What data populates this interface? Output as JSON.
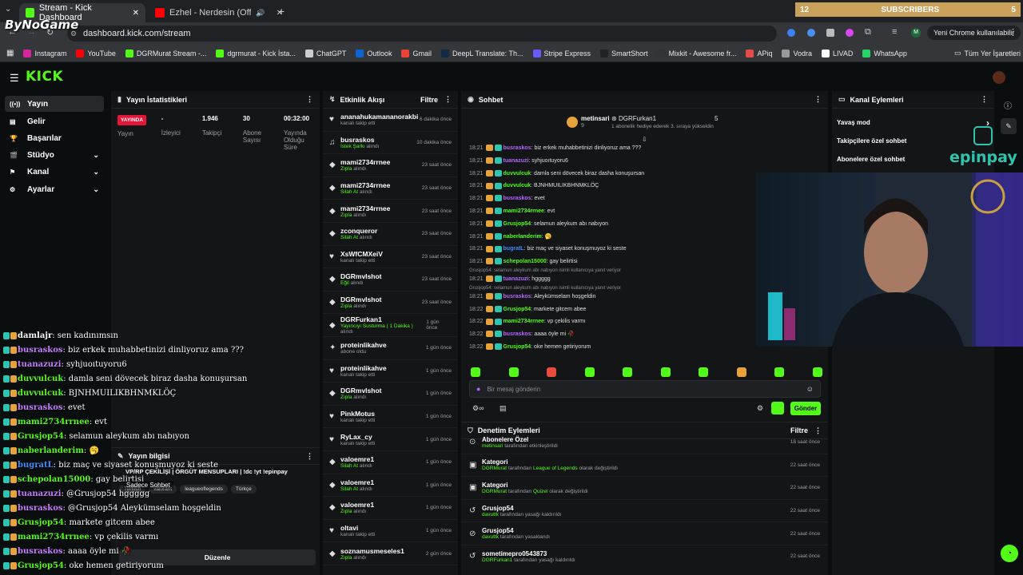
{
  "browser": {
    "tabs": [
      {
        "title": "Stream - Kick Dashboard"
      },
      {
        "title": "Ezhel - Nerdesin (Official Au"
      }
    ],
    "url": "dashboard.kick.com/stream",
    "profile_button": "Yeni Chrome kullanılabilir",
    "bookmarks": [
      {
        "label": "Instagram",
        "color": "#d6249f"
      },
      {
        "label": "YouTube",
        "color": "#ff0000"
      },
      {
        "label": "DGRMurat Stream -...",
        "color": "#53fc18"
      },
      {
        "label": "dgrmurat - Kick İsta...",
        "color": "#53fc18"
      },
      {
        "label": "ChatGPT",
        "color": "#cccccc"
      },
      {
        "label": "Outlook",
        "color": "#0a64d6"
      },
      {
        "label": "Gmail",
        "color": "#ea4335"
      },
      {
        "label": "DeepL Translate: Th...",
        "color": "#0f2b46"
      },
      {
        "label": "Stripe Express",
        "color": "#635bff"
      },
      {
        "label": "SmartShort",
        "color": "#222222"
      },
      {
        "label": "Mixkit - Awesome fr...",
        "color": "#333333"
      },
      {
        "label": "APiq",
        "color": "#e64a4a"
      },
      {
        "label": "Vodra",
        "color": "#999999"
      },
      {
        "label": "LIVAD",
        "color": "#ffffff"
      },
      {
        "label": "WhatsApp",
        "color": "#25d366"
      }
    ],
    "all_bookmarks": "Tüm Yer İşaretleri"
  },
  "overlay": {
    "logo": "ByNoGame",
    "subscribers_count_left": "12",
    "subscribers_label": "SUBSCRIBERS",
    "subscribers_count_right": "5",
    "sponsor": "epinpay"
  },
  "sidebar": {
    "items": [
      {
        "label": "Yayın",
        "icon": "broadcast-icon",
        "glyph": "((•))"
      },
      {
        "label": "Gelir",
        "icon": "wallet-icon",
        "glyph": "▤"
      },
      {
        "label": "Başarılar",
        "icon": "trophy-icon",
        "glyph": "🏆"
      },
      {
        "label": "Stüdyo",
        "icon": "studio-icon",
        "glyph": "🎬"
      },
      {
        "label": "Kanal",
        "icon": "channel-icon",
        "glyph": "⚑"
      },
      {
        "label": "Ayarlar",
        "icon": "settings-icon",
        "glyph": "⚙"
      }
    ]
  },
  "stats": {
    "title": "Yayın İstatistikleri",
    "live_badge": "YAYINDA",
    "live_label": "Yayın",
    "viewers_value": "-",
    "viewers_label": "İzleyici",
    "followers_value": "1.946",
    "followers_label": "Takipçi",
    "subs_value": "30",
    "subs_label": "Abone Sayısı",
    "uptime_value": "00:32:00",
    "uptime_label": "Yayında Olduğu Süre"
  },
  "stream_info": {
    "title": "Yayın bilgisi",
    "stream_title": "VP/RP ÇEKİLİŞİ | ÖRGÜT MENSUPLARI | !dc !yt !epinpay",
    "tags": [
      "Turkish",
      "valorant",
      "leagueoflegends",
      "Türkçe"
    ],
    "edit_button": "Düzenle"
  },
  "activity": {
    "title": "Etkinlik Akışı",
    "filter": "Filtre",
    "items": [
      {
        "icon": "♥",
        "user": "ananahukamananorakbi",
        "action": "kanalı takip etti",
        "highlight": "",
        "time": "6 dakika önce"
      },
      {
        "icon": "♫",
        "user": "busraskos",
        "action": "alındı",
        "highlight": "İstek Şarkı",
        "time": "10 dakika önce"
      },
      {
        "icon": "◆",
        "user": "mami2734rrnee",
        "action": "alındı",
        "highlight": "Zıpla",
        "time": "23 saat önce"
      },
      {
        "icon": "◆",
        "user": "mami2734rrnee",
        "action": "alındı",
        "highlight": "Silah At",
        "time": "23 saat önce"
      },
      {
        "icon": "◆",
        "user": "mami2734rrnee",
        "action": "alındı",
        "highlight": "Zıpla",
        "time": "23 saat önce"
      },
      {
        "icon": "◆",
        "user": "zconqueror",
        "action": "alındı",
        "highlight": "Silah At",
        "time": "23 saat önce"
      },
      {
        "icon": "♥",
        "user": "XsWfCMXeiV",
        "action": "kanalı takip etti",
        "highlight": "",
        "time": "23 saat önce"
      },
      {
        "icon": "◆",
        "user": "DGRmvlshot",
        "action": "alındı",
        "highlight": "Eğil",
        "time": "23 saat önce"
      },
      {
        "icon": "◆",
        "user": "DGRmvlshot",
        "action": "alındı",
        "highlight": "Zıpla",
        "time": "23 saat önce"
      },
      {
        "icon": "◆",
        "user": "DGRFurkan1",
        "action": "alındı",
        "highlight": "Yayıncıyı Susturma ( 1 Dakika )",
        "time": "1 gün önce"
      },
      {
        "icon": "✦",
        "user": "proteinlikahve",
        "action": "abone oldu",
        "highlight": "",
        "time": "1 gün önce"
      },
      {
        "icon": "♥",
        "user": "proteinlikahve",
        "action": "kanalı takip etti",
        "highlight": "",
        "time": "1 gün önce"
      },
      {
        "icon": "◆",
        "user": "DGRmvlshot",
        "action": "alındı",
        "highlight": "Zıpla",
        "time": "1 gün önce"
      },
      {
        "icon": "♥",
        "user": "PinkMotus",
        "action": "kanalı takip etti",
        "highlight": "",
        "time": "1 gün önce"
      },
      {
        "icon": "♥",
        "user": "RyLax_cy",
        "action": "kanalı takip etti",
        "highlight": "",
        "time": "1 gün önce"
      },
      {
        "icon": "◆",
        "user": "valoemre1",
        "action": "alındı",
        "highlight": "Silah At",
        "time": "1 gün önce"
      },
      {
        "icon": "◆",
        "user": "valoemre1",
        "action": "alındı",
        "highlight": "Silah At",
        "time": "1 gün önce"
      },
      {
        "icon": "◆",
        "user": "valoemre1",
        "action": "alındı",
        "highlight": "Zıpla",
        "time": "1 gün önce"
      },
      {
        "icon": "♥",
        "user": "oltavi",
        "action": "kanalı takip etti",
        "highlight": "",
        "time": "1 gün önce"
      },
      {
        "icon": "◆",
        "user": "soznamusmeseles1",
        "action": "alındı",
        "highlight": "Zıpla",
        "time": "2 gün önce"
      }
    ]
  },
  "chat": {
    "title": "Sohbet",
    "pinned_user": "metinsari",
    "pinned_level": "9",
    "gifter": "DGRFurkan1",
    "gift_count": "5",
    "gift_text": "1 abonelik hediye ederek 3. sıraya yükseldin",
    "messages": [
      {
        "time": "18:21",
        "user": "busraskos",
        "color": "#b765ff",
        "text": ": biz erkek muhabbetinizi dinliyoruz ama ???"
      },
      {
        "time": "18:21",
        "user": "tuanazuzi",
        "color": "#b765ff",
        "text": ": syhjuoıtuyoru6"
      },
      {
        "time": "18:21",
        "user": "duvvulcuk",
        "color": "#53fc18",
        "text": ": damla seni dövecek biraz dasha konuşursan"
      },
      {
        "time": "18:21",
        "user": "duvvulcuk",
        "color": "#53fc18",
        "text": ": BJNHMUILIKBHNMKLÖÇ"
      },
      {
        "time": "18:21",
        "user": "busraskos",
        "color": "#b765ff",
        "text": ": evet"
      },
      {
        "time": "18:21",
        "user": "mami2734rrnee",
        "color": "#53fc18",
        "text": ": evt"
      },
      {
        "time": "18:21",
        "user": "Grusjop54",
        "color": "#53fc18",
        "text": ": selamun aleykum abı nabıyon"
      },
      {
        "time": "18:21",
        "user": "naberlanderim",
        "color": "#53fc18",
        "text": ": 🥱"
      },
      {
        "time": "18:21",
        "user": "bugratL",
        "color": "#3f8cff",
        "text": ": biz maç ve siyaset konuşmuyoz ki seste"
      },
      {
        "time": "18:21",
        "user": "schepolan15000",
        "color": "#53fc18",
        "text": ": gay belirtisi"
      },
      {
        "time": "18:21",
        "user": "tuanazuzi",
        "color": "#b765ff",
        "text": ": hggggg",
        "note": "Grusjop54: selamun aleykum abı nabıyon isimli kullanıcıya yanıt veriyor"
      },
      {
        "time": "18:21",
        "user": "busraskos",
        "color": "#b765ff",
        "text": ": Aleykümselam hoşgeldin",
        "note": "Grusjop54: selamun aleykum abı nabıyon isimli kullanıcıya yanıt veriyor"
      },
      {
        "time": "18:22",
        "user": "Grusjop54",
        "color": "#53fc18",
        "text": ": markete gitcem abee"
      },
      {
        "time": "18:22",
        "user": "mami2734rrnee",
        "color": "#53fc18",
        "text": ": vp çekilis varmı"
      },
      {
        "time": "18:22",
        "user": "busraskos",
        "color": "#b765ff",
        "text": ": aaaa öyle mi 🥀"
      },
      {
        "time": "18:22",
        "user": "Grusjop54",
        "color": "#53fc18",
        "text": ": oke hemen getiriyorum"
      }
    ],
    "input_placeholder": "Bir mesaj gönderin",
    "send_button": "Gönder",
    "emote_colors": [
      "#53fc18",
      "#53fc18",
      "#e74c3c",
      "#53fc18",
      "#53fc18",
      "#53fc18",
      "#53fc18",
      "#e7a23c",
      "#53fc18",
      "#53fc18"
    ]
  },
  "channel_actions": {
    "title": "Kanal Eylemleri",
    "items": [
      "Yavaş mod",
      "Takipçilere özel sohbet",
      "Abonelere özel sohbet"
    ]
  },
  "moderation": {
    "title": "Denetim Eylemleri",
    "filter": "Filtre",
    "items": [
      {
        "icon": "⊙",
        "title": "Abonelere Özel",
        "actor": "metinsari",
        "mid": "tarafından etkinleştirildi",
        "target": "",
        "tail": "",
        "time": "18 saat önce"
      },
      {
        "icon": "▣",
        "title": "Kategori",
        "actor": "DGRMurat",
        "mid": "tarafından",
        "target": "League of Legends",
        "tail": "olarak değiştirildi",
        "time": "22 saat önce"
      },
      {
        "icon": "▣",
        "title": "Kategori",
        "actor": "DGRMurat",
        "mid": "tarafından",
        "target": "Quizel",
        "tail": "olarak değiştirildi",
        "time": "22 saat önce"
      },
      {
        "icon": "↺",
        "title": "Grusjop54",
        "actor": "davuttk",
        "mid": "tarafından yasağı kaldırıldı",
        "target": "",
        "tail": "",
        "time": "22 saat önce"
      },
      {
        "icon": "⊘",
        "title": "Grusjop54",
        "actor": "davuttk",
        "mid": "tarafından yasaklandı",
        "target": "",
        "tail": "",
        "time": "22 saat önce"
      },
      {
        "icon": "↺",
        "title": "sometimepro0543873",
        "actor": "DGRFurkan1",
        "mid": "tarafından yasağı kaldırıldı",
        "target": "",
        "tail": "",
        "time": "22 saat önce"
      }
    ]
  },
  "overlay_chat": [
    {
      "user": "damlajr",
      "color": "#ffffff",
      "text": ": sen kadınımsın"
    },
    {
      "user": "busraskos",
      "color": "#c77dff",
      "text": ": biz erkek muhabbetinizi dinliyoruz ama ???"
    },
    {
      "user": "tuanazuzi",
      "color": "#c77dff",
      "text": ": syhjuoıtuyoru6"
    },
    {
      "user": "duvvulcuk",
      "color": "#53fc18",
      "text": ": damla seni dövecek biraz dasha konuşursan"
    },
    {
      "user": "duvvulcuk",
      "color": "#53fc18",
      "text": ": BJNHMUILIKBHNMKLÖÇ"
    },
    {
      "user": "busraskos",
      "color": "#c77dff",
      "text": ": evet"
    },
    {
      "user": "mami2734rrnee",
      "color": "#53fc18",
      "text": ": evt"
    },
    {
      "user": "Grusjop54",
      "color": "#53fc18",
      "text": ": selamun aleykum abı nabıyon"
    },
    {
      "user": "naberlanderim",
      "color": "#53fc18",
      "text": ": 🥱"
    },
    {
      "user": "bugratL",
      "color": "#3f8cff",
      "text": ": biz maç ve siyaset konuşmuyoz ki seste"
    },
    {
      "user": "schepolan15000",
      "color": "#53fc18",
      "text": ": gay belirtisi"
    },
    {
      "user": "tuanazuzi",
      "color": "#c77dff",
      "text": ": @Grusjop54 hggggg"
    },
    {
      "user": "busraskos",
      "color": "#c77dff",
      "text": ": @Grusjop54 Aleykümselam hoşgeldin"
    },
    {
      "user": "Grusjop54",
      "color": "#53fc18",
      "text": ": markete gitcem abee"
    },
    {
      "user": "mami2734rrnee",
      "color": "#53fc18",
      "text": ": vp çekilis varmı"
    },
    {
      "user": "busraskos",
      "color": "#c77dff",
      "text": ": aaaa öyle mi 🥀"
    },
    {
      "user": "Grusjop54",
      "color": "#53fc18",
      "text": ": oke hemen getiriyorum"
    }
  ],
  "overlay_alert": "Sadece Sohbet",
  "colors": {
    "kick_green": "#53fc18",
    "live_red": "#e4163a",
    "panel": "#141517"
  }
}
